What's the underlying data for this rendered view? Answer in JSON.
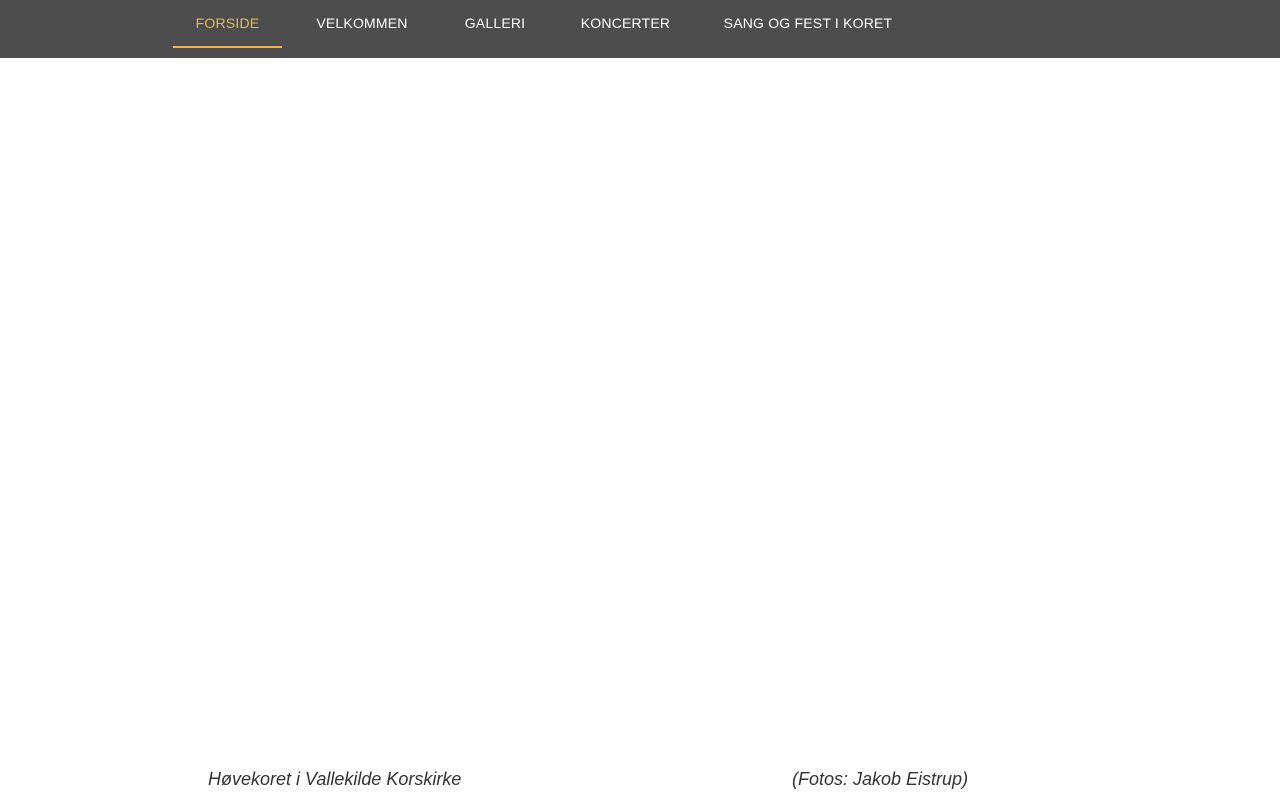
{
  "colors": {
    "nav_background": "#4d4d4d",
    "nav_text": "#ffffff",
    "nav_active": "#f0b84a",
    "page_background": "#ffffff",
    "caption_text": "#333333"
  },
  "nav": {
    "active_index": 0,
    "items": [
      {
        "label": "FORSIDE"
      },
      {
        "label": "VELKOMMEN"
      },
      {
        "label": "GALLERI"
      },
      {
        "label": "KONCERTER"
      },
      {
        "label": "SANG OG FEST I KORET"
      }
    ]
  },
  "captions": {
    "left": "Høvekoret i Vallekilde Korskirke",
    "right": "(Fotos: Jakob Eistrup)"
  }
}
